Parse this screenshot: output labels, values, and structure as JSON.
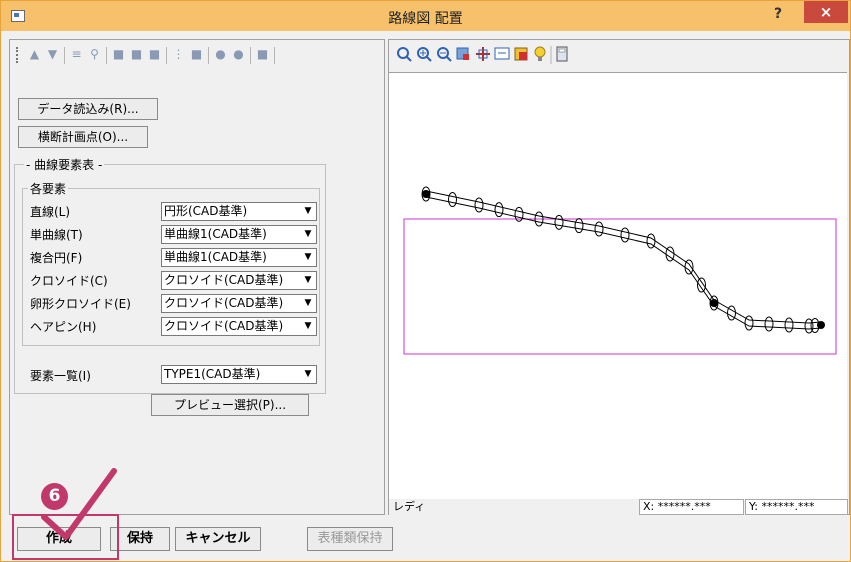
{
  "window": {
    "title": "路線図 配置",
    "help_label": "?",
    "close_label": "×"
  },
  "left": {
    "read_data_button": "データ読込み(R)...",
    "cross_plan_button": "横断計画点(O)...",
    "curve_table_legend": "- 曲線要素表 -",
    "elements_legend": "各要素",
    "rows": [
      {
        "label": "直線(L)",
        "value": "円形(CAD基準)"
      },
      {
        "label": "単曲線(T)",
        "value": "単曲線1(CAD基準)"
      },
      {
        "label": "複合円(F)",
        "value": "単曲線1(CAD基準)"
      },
      {
        "label": "クロソイド(C)",
        "value": "クロソイド(CAD基準)"
      },
      {
        "label": "卵形クロソイド(E)",
        "value": "クロソイド(CAD基準)"
      },
      {
        "label": "ヘアピン(H)",
        "value": "クロソイド(CAD基準)"
      }
    ],
    "element_list": {
      "label": "要素一覧(I)",
      "value": "TYPE1(CAD基準)"
    },
    "preview_button": "プレビュー選択(P)..."
  },
  "status": {
    "text": "レディ",
    "x": "X: ******.***",
    "y": "Y: ******.***"
  },
  "bottom": {
    "create": "作成",
    "keep": "保持",
    "cancel": "キャンセル",
    "keep_table": "表種類保持"
  },
  "callout": {
    "step": "6"
  },
  "colors": {
    "titlebar": "#f7c06a",
    "frame": "#e8a33b",
    "close": "#c94a3d",
    "callout": "#c2386b",
    "route_box": "#cc33cc"
  }
}
